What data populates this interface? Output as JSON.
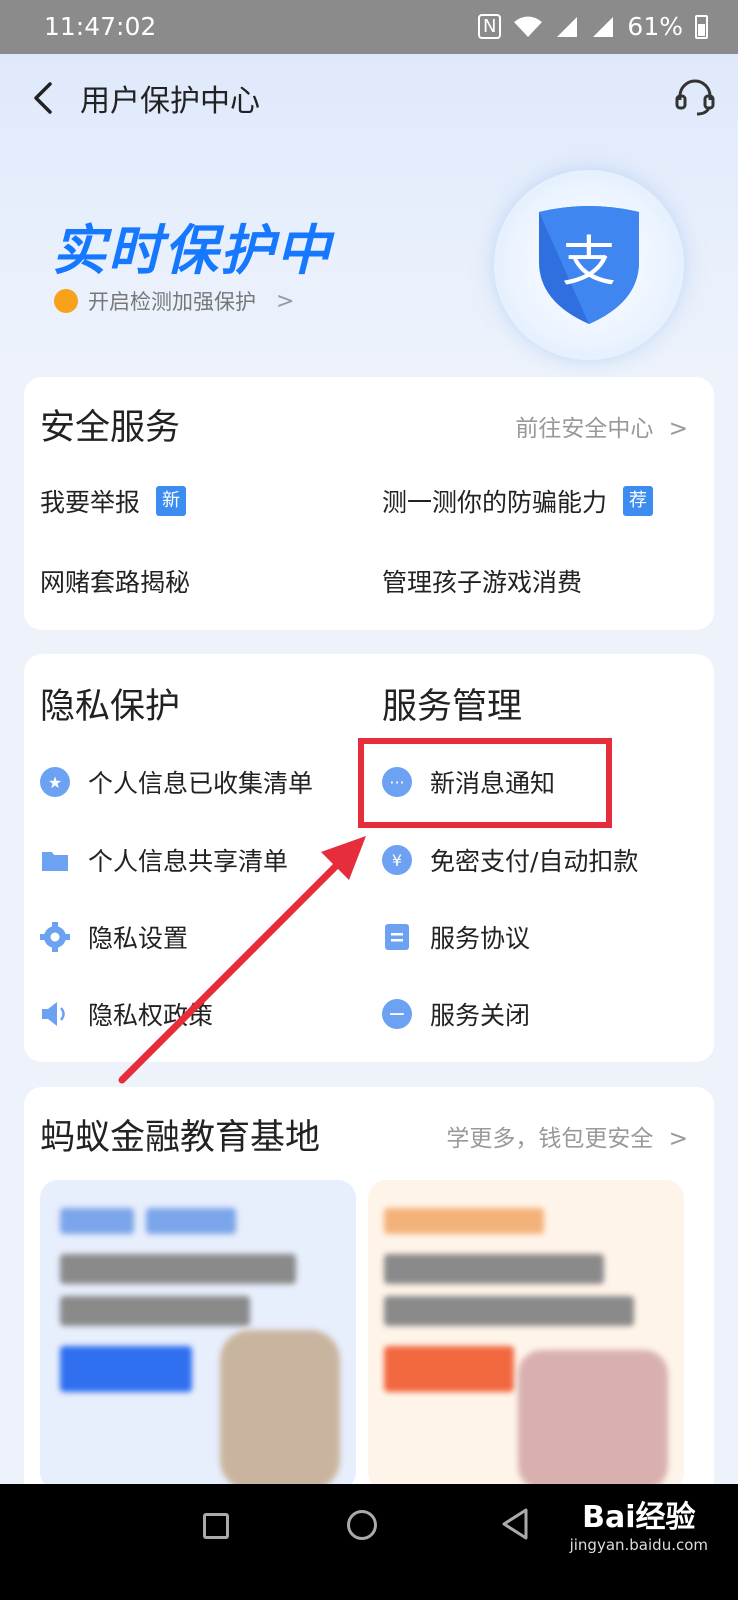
{
  "status_bar": {
    "time": "11:47:02",
    "battery": "61%",
    "nfc": "N"
  },
  "header": {
    "title": "用户保护中心"
  },
  "hero": {
    "title": "实时保护中",
    "subtitle": "开启检测加强保护",
    "logo_char": "支"
  },
  "security": {
    "title": "安全服务",
    "link": "前往安全中心",
    "items": [
      {
        "label": "我要举报",
        "badge": "新"
      },
      {
        "label": "测一测你的防骗能力",
        "badge": "荐"
      },
      {
        "label": "网赌套路揭秘"
      },
      {
        "label": "管理孩子游戏消费"
      }
    ]
  },
  "privacy": {
    "title": "隐私保护",
    "items": [
      {
        "label": "个人信息已收集清单",
        "icon": "star-icon"
      },
      {
        "label": "个人信息共享清单",
        "icon": "folder-icon"
      },
      {
        "label": "隐私设置",
        "icon": "gear-icon"
      },
      {
        "label": "隐私权政策",
        "icon": "speaker-icon"
      }
    ]
  },
  "service": {
    "title": "服务管理",
    "items": [
      {
        "label": "新消息通知",
        "icon": "message-icon"
      },
      {
        "label": "免密支付/自动扣款",
        "icon": "yuan-icon",
        "icon_char": "¥"
      },
      {
        "label": "服务协议",
        "icon": "document-icon"
      },
      {
        "label": "服务关闭",
        "icon": "minus-icon"
      }
    ]
  },
  "education": {
    "title": "蚂蚁金融教育基地",
    "link": "学更多，钱包更安全"
  },
  "watermark": {
    "main": "Bai经验",
    "sub": "jingyan.baidu.com"
  },
  "colors": {
    "accent": "#1677ff",
    "highlight": "#e52d3c",
    "badge": "#3d8cf0"
  }
}
